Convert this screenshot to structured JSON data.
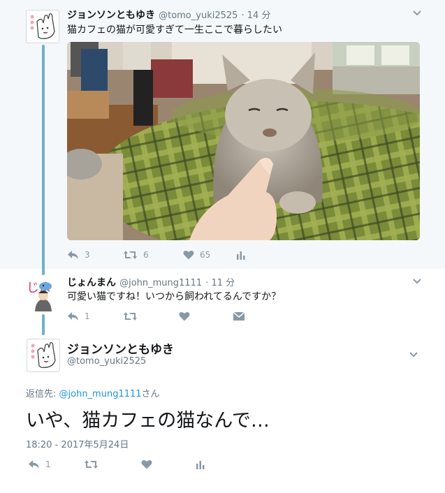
{
  "tweet1": {
    "name": "ジョンソンともゆき",
    "handle": "@tomo_yuki2525",
    "time": "· 14 分",
    "text": "猫カフェの猫が可愛すぎて一生ここで暮らしたい",
    "replies": "3",
    "retweets": "6",
    "likes": "65"
  },
  "tweet2": {
    "avatar_text": "じよ",
    "name": "じょんまん",
    "handle": "@john_mung1111",
    "time": "· 11 分",
    "text": "可愛い猫ですね！いつから飼われてるんですか？",
    "replies": "1"
  },
  "tweet3": {
    "name": "ジョンソンともゆき",
    "handle": "@tomo_yuki2525",
    "reply_prefix": "返信先: ",
    "reply_user": "@john_mung1111",
    "reply_suffix": "さん",
    "text": "いや、猫カフェの猫なんで…",
    "date": "18:20 - 2017年5月24日",
    "replies": "1"
  },
  "colors": {
    "accent": "#1b95e0",
    "thread": "#6fb0cc",
    "icon": "#8899a6"
  }
}
